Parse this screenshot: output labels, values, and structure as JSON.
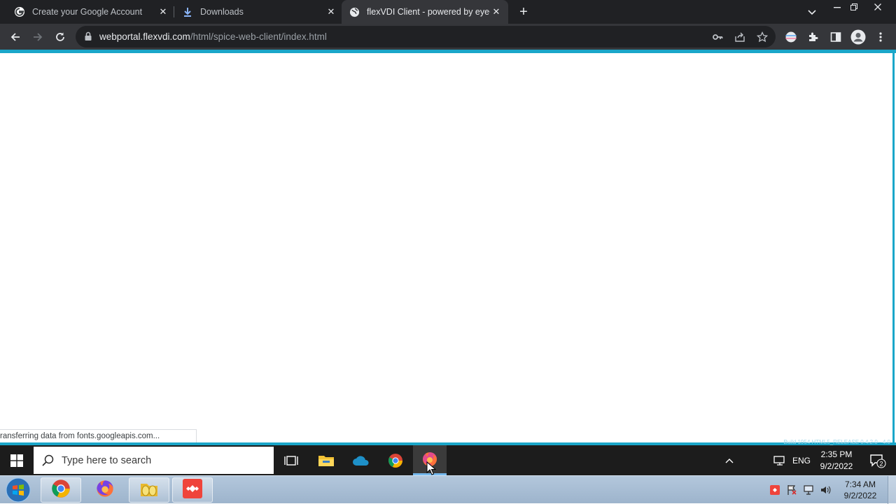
{
  "browser": {
    "tabs": [
      {
        "title": "Create your Google Account",
        "icon": "google-g-icon",
        "active": false
      },
      {
        "title": "Downloads",
        "icon": "download-icon",
        "active": false
      },
      {
        "title": "flexVDI Client - powered by eyeC",
        "icon": "globe-icon",
        "active": true
      }
    ],
    "close_glyph": "✕",
    "new_tab_glyph": "+",
    "address": {
      "host": "webportal.flexvdi.com",
      "path": "/html/spice-web-client/index.html"
    },
    "accent_color": "#1aa6c9"
  },
  "page": {
    "status_text": "ransferring data from fonts.googleapis.com...",
    "remote_build_text": "Build 1954 HTML5_RELEASE 0.4.2.0 - 4.0"
  },
  "remote_taskbar": {
    "search_placeholder": "Type here to search",
    "language": "ENG",
    "time": "2:35 PM",
    "date": "9/2/2022",
    "notification_count": "2",
    "pinned_icons": [
      "task-view-icon",
      "file-explorer-icon",
      "onedrive-icon",
      "chrome-icon",
      "firefox-icon"
    ]
  },
  "local_taskbar": {
    "time": "7:34 AM",
    "date": "9/2/2022",
    "pinned_icons": [
      "chrome-icon",
      "firefox-icon",
      "file-manager-icon",
      "anydesk-icon"
    ]
  }
}
